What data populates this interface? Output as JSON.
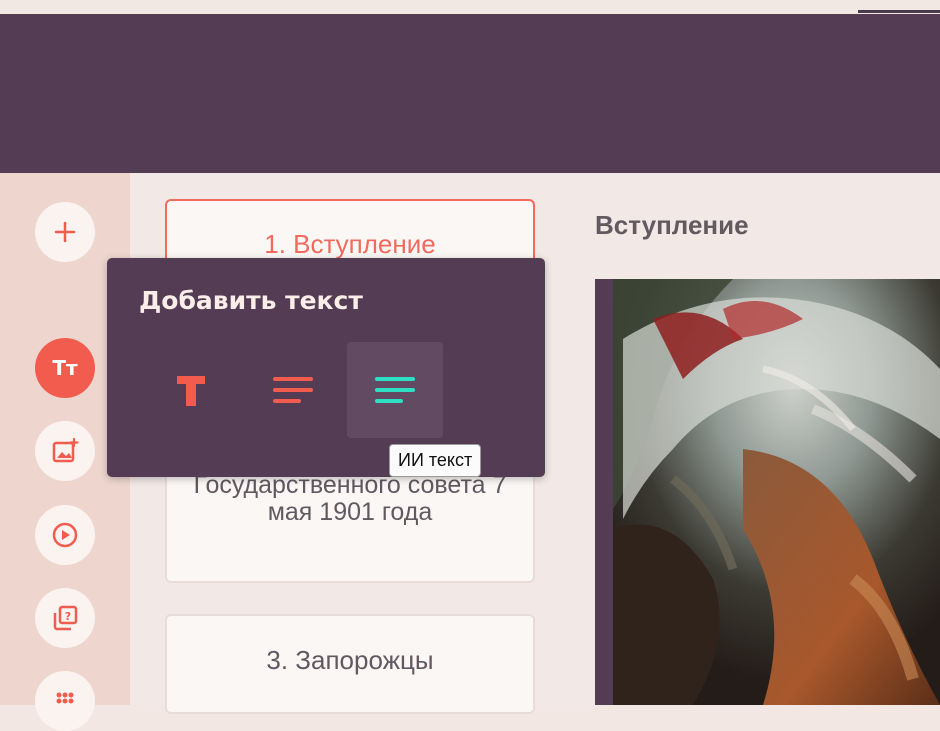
{
  "sidebar": {
    "buttons": [
      {
        "name": "add",
        "icon": "plus-icon"
      },
      {
        "name": "text",
        "icon": "text-icon",
        "glyph": "Тт",
        "active": true
      },
      {
        "name": "image",
        "icon": "add-image-icon"
      },
      {
        "name": "video",
        "icon": "play-icon"
      },
      {
        "name": "quiz",
        "icon": "question-cards-icon"
      },
      {
        "name": "more",
        "icon": "grid-dots-icon"
      }
    ]
  },
  "slides": [
    {
      "label": "1. Вступление",
      "selected": true
    },
    {
      "label": "Государственного совета 7 мая 1901 года"
    },
    {
      "label": "3. Запорожцы"
    }
  ],
  "editor": {
    "slide_title": "Вступление"
  },
  "add_text_popup": {
    "title": "Добавить текст",
    "tools": [
      {
        "name": "heading",
        "icon": "heading-t-icon"
      },
      {
        "name": "paragraph",
        "icon": "paragraph-lines-icon"
      },
      {
        "name": "ai-text",
        "icon": "ai-lines-icon",
        "hovered": true
      }
    ],
    "tooltip": "ИИ текст"
  },
  "colors": {
    "accent": "#f25c4f",
    "header": "#533c54",
    "ai_teal": "#2de0c4"
  }
}
